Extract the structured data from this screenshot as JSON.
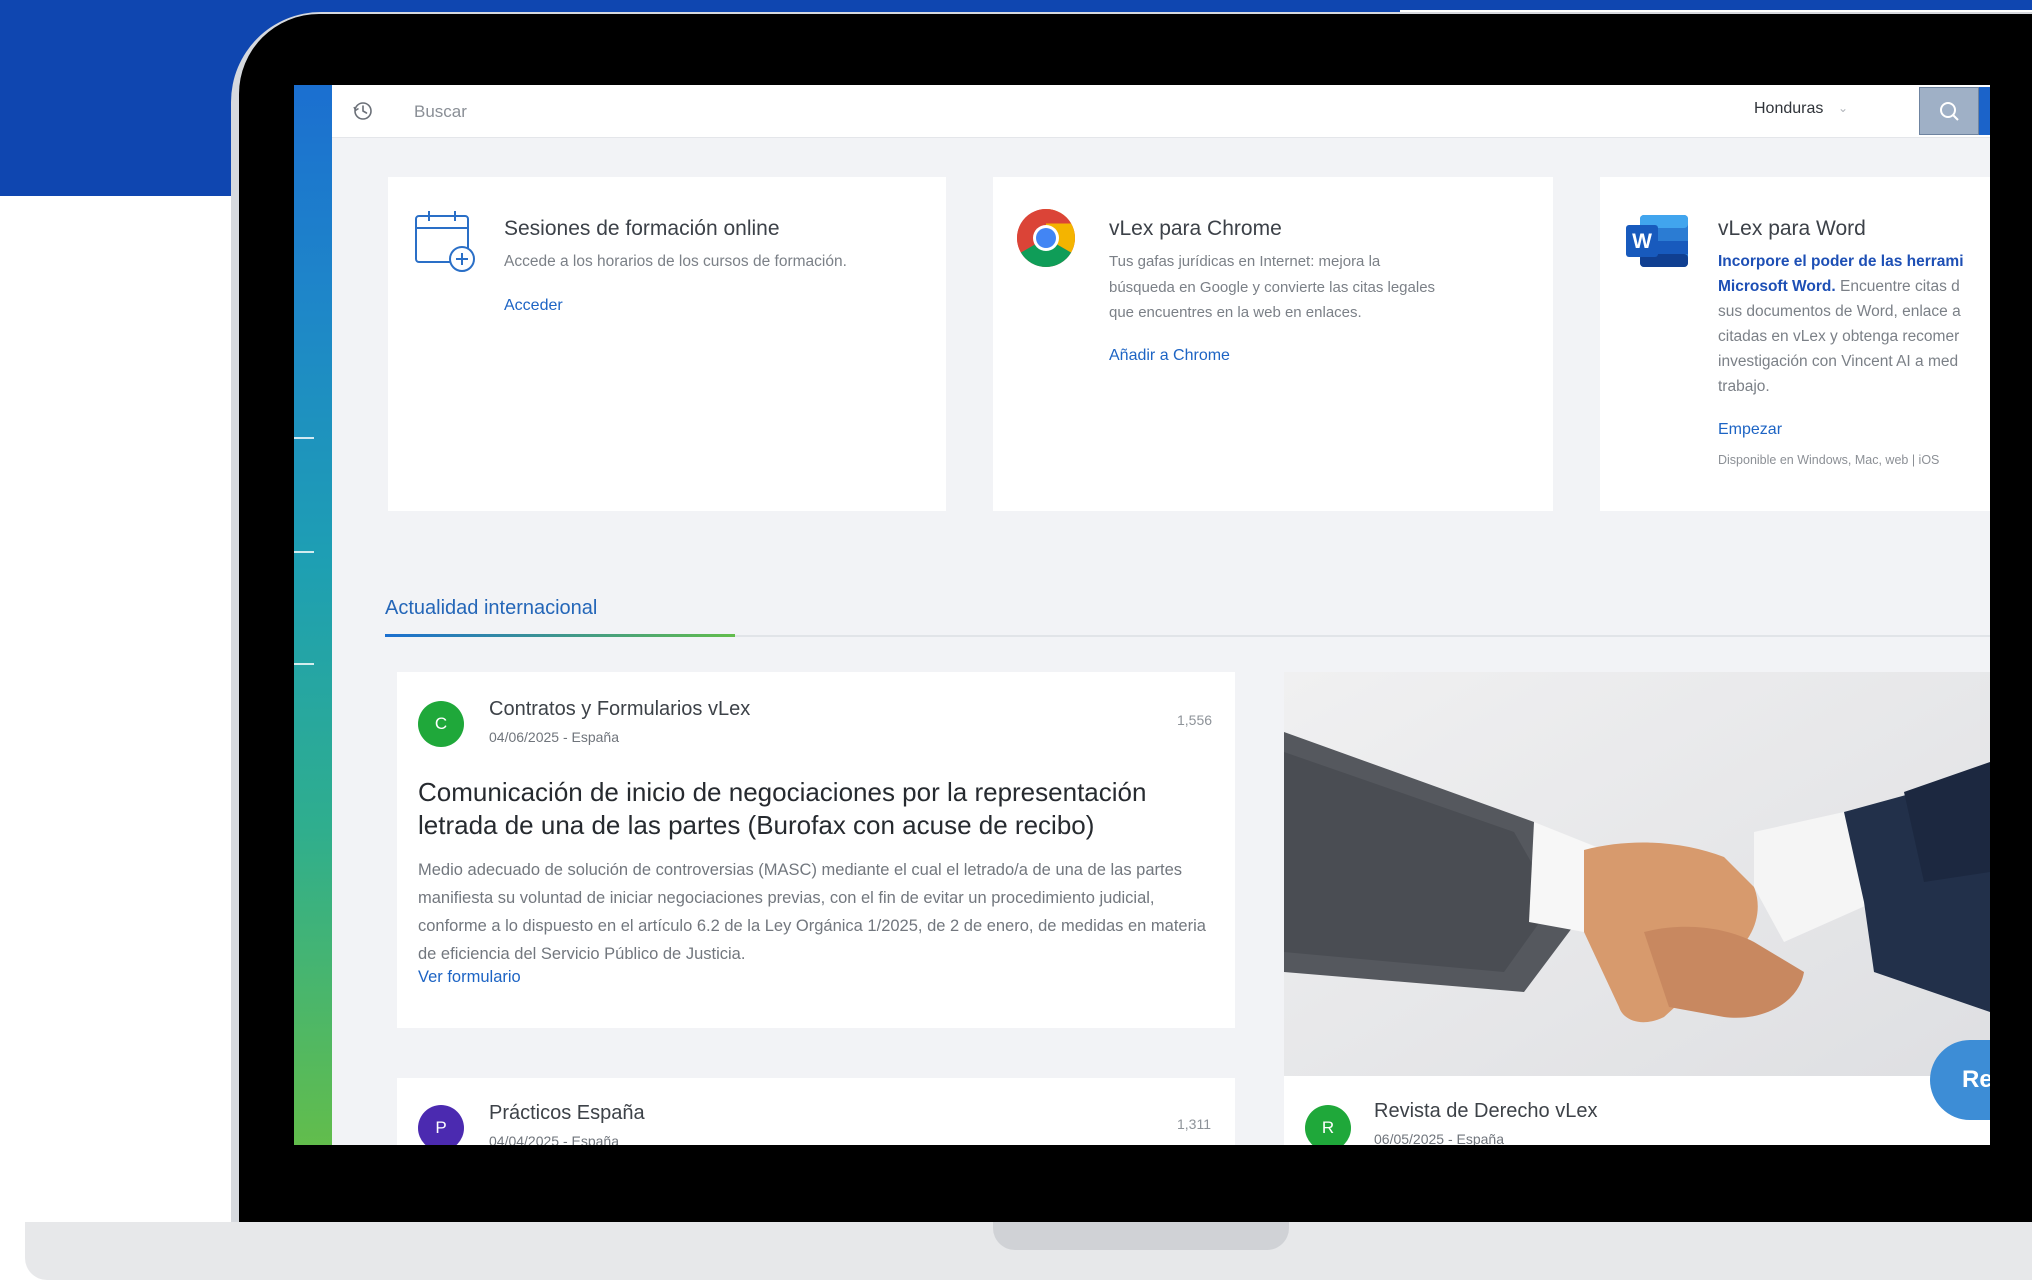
{
  "search": {
    "placeholder": "Buscar"
  },
  "topbar": {
    "country": "Honduras",
    "chevron": "⌄"
  },
  "cards": [
    {
      "title": "Sesiones de formación online",
      "desc": "Accede a los horarios de los cursos de formación.",
      "link": "Acceder"
    },
    {
      "title": "vLex para Chrome",
      "desc_lines": [
        "Tus gafas jurídicas en Internet: mejora la",
        "búsqueda en Google y convierte las citas legales",
        "que encuentres en la web en enlaces."
      ],
      "link": "Añadir a Chrome"
    },
    {
      "title": "vLex para Word",
      "desc_bold_1": "Incorpore el poder de las herrami",
      "desc_bold_2": "Microsoft Word.",
      "desc_rest_2": " Encuentre citas d",
      "desc_lines": [
        "sus documentos de Word, enlace a",
        "citadas en vLex y obtenga recomer",
        "investigación con Vincent AI a med",
        "trabajo."
      ],
      "link": "Empezar",
      "note": "Disponible en Windows, Mac, web | iOS",
      "icon_letter": "W"
    }
  ],
  "section": {
    "title": "Actualidad internacional"
  },
  "news": [
    {
      "avatar": "C",
      "avatar_color": "#1fa83a",
      "publisher": "Contratos y Formularios vLex",
      "meta": "04/06/2025 - España",
      "views": "1,556",
      "headline": "Comunicación de inicio de negociaciones por la representación letrada de una de las partes (Burofax con acuse de recibo)",
      "summary": "Medio adecuado de solución de controversias (MASC) mediante el cual el letrado/a de una de las partes manifiesta su voluntad de iniciar negociaciones previas, con el fin de evitar un procedimiento judicial, conforme a lo dispuesto en el artículo 6.2 de la Ley Orgánica 1/2025, de 2 de enero, de medidas en materia de eficiencia del Servicio Público de Justicia.",
      "link": "Ver formulario"
    },
    {
      "avatar": "P",
      "avatar_color": "#4b2ab0",
      "publisher": "Prácticos España",
      "meta": "04/04/2025 - España",
      "views": "1,311"
    },
    {
      "avatar": "R",
      "avatar_color": "#1fa83a",
      "publisher": "Revista de Derecho vLex",
      "meta": "06/05/2025 - España"
    }
  ],
  "fab": {
    "label": "Re"
  },
  "colors": {
    "brand_blue": "#0f46b0",
    "link": "#1d64c4",
    "accent_green": "#62bd4c"
  }
}
